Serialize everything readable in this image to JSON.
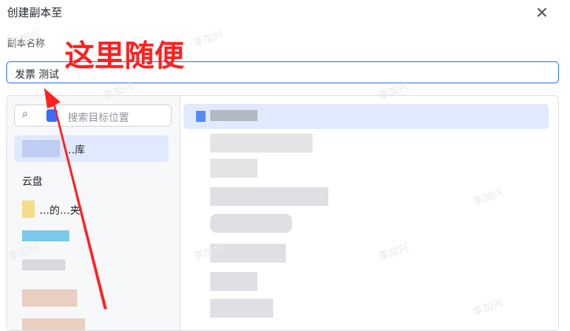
{
  "dialog": {
    "title": "创建副本至",
    "close_icon": "close-icon"
  },
  "name_field": {
    "label": "副本名称",
    "value": "发票 测试"
  },
  "search": {
    "placeholder": "搜索目标位置"
  },
  "left_items": [
    {
      "label": "…库"
    },
    {
      "label": "云盘"
    },
    {
      "label": "…的…夹"
    },
    {
      "label": ""
    },
    {
      "label": ""
    }
  ],
  "annotation": {
    "text": "这里随便",
    "color": "#ff2020"
  },
  "watermark": "李加兴",
  "colors": {
    "accent": "#3370ff",
    "selected_bg": "#e1e9ff"
  }
}
